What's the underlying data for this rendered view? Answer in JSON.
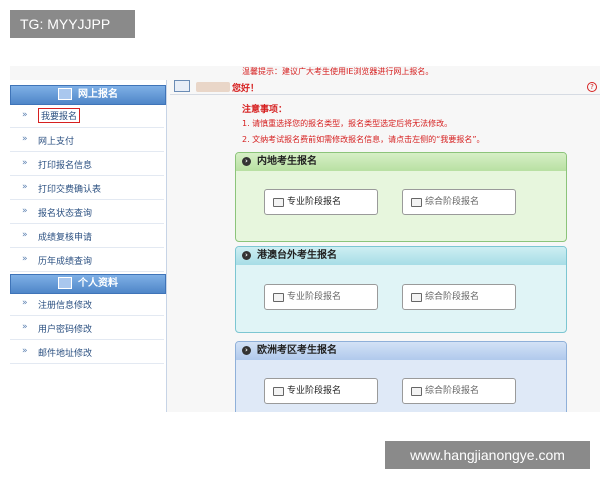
{
  "watermark": {
    "top_left": "TG: MYYJJPP",
    "bottom_right": "www.hangjianongye.com"
  },
  "top_notice": "温馨提示：建议广大考生使用IE浏览器进行网上报名。",
  "greeting": "您好！",
  "sidebar": {
    "sections": [
      {
        "title": "网上报名",
        "items": [
          {
            "label": "我要报名",
            "active": true
          },
          {
            "label": "网上支付"
          },
          {
            "label": "打印报名信息"
          },
          {
            "label": "打印交费确认表"
          },
          {
            "label": "报名状态查询"
          },
          {
            "label": "成绩复核申请"
          },
          {
            "label": "历年成绩查询"
          }
        ]
      },
      {
        "title": "个人资料",
        "items": [
          {
            "label": "注册信息修改"
          },
          {
            "label": "用户密码修改"
          },
          {
            "label": "邮件地址修改"
          }
        ]
      }
    ]
  },
  "notes": {
    "title": "注意事项：",
    "items": [
      "1. 请慎重选择您的报名类型，报名类型选定后将无法修改。",
      "2. 文纳考试报名费前如需修改报名信息，请点击左侧的“我要报名”。"
    ]
  },
  "panels": [
    {
      "title": "内地考生报名",
      "buttons": [
        "专业阶段报名",
        "综合阶段报名"
      ]
    },
    {
      "title": "港澳台外考生报名",
      "buttons": [
        "专业阶段报名",
        "综合阶段报名"
      ]
    },
    {
      "title": "欧洲考区考生报名",
      "buttons": [
        "专业阶段报名",
        "综合阶段报名"
      ]
    }
  ],
  "colors": {
    "accent_red": "#d62020",
    "sidebar_blue": "#4f86c8",
    "green_panel": "#e7f6dd",
    "cyan_panel": "#e0f4f6",
    "blue_panel": "#dfe9f7"
  }
}
